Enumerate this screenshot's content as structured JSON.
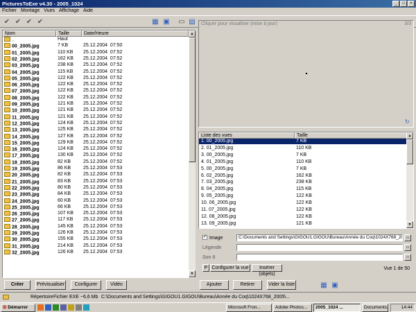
{
  "window": {
    "title": "PicturesToExe v4.30 - 2005_1024"
  },
  "menu": [
    "Fichier",
    "Montage",
    "Vues",
    "Affichage",
    "Aide"
  ],
  "file_list": {
    "columns": [
      "Nom",
      "Taille",
      "Date/Heure"
    ],
    "rows": [
      {
        "name": "..",
        "size": "Haut",
        "date": ""
      },
      {
        "name": "00_2005.jpg",
        "size": "7 KB",
        "date": "25.12.2004  07:50"
      },
      {
        "name": "01_2005.jpg",
        "size": "110 KB",
        "date": "25.12.2004  07:52"
      },
      {
        "name": "02_2005.jpg",
        "size": "162 KB",
        "date": "25.12.2004  07:52"
      },
      {
        "name": "03_2005.jpg",
        "size": "238 KB",
        "date": "25.12.2004  07:52"
      },
      {
        "name": "04_2005.jpg",
        "size": "115 KB",
        "date": "25.12.2004  07:52"
      },
      {
        "name": "05_2005.jpg",
        "size": "122 KB",
        "date": "25.12.2004  07:52"
      },
      {
        "name": "06_2005.jpg",
        "size": "122 KB",
        "date": "25.12.2004  07:52"
      },
      {
        "name": "07_2005.jpg",
        "size": "122 KB",
        "date": "25.12.2004  07:52"
      },
      {
        "name": "08_2005.jpg",
        "size": "122 KB",
        "date": "25.12.2004  07:52"
      },
      {
        "name": "09_2005.jpg",
        "size": "121 KB",
        "date": "25.12.2004  07:52"
      },
      {
        "name": "10_2005.jpg",
        "size": "121 KB",
        "date": "25.12.2004  07:52"
      },
      {
        "name": "11_2005.jpg",
        "size": "121 KB",
        "date": "25.12.2004  07:52"
      },
      {
        "name": "12_2005.jpg",
        "size": "124 KB",
        "date": "25.12.2004  07:52"
      },
      {
        "name": "13_2005.jpg",
        "size": "125 KB",
        "date": "25.12.2004  07:52"
      },
      {
        "name": "14_2005.jpg",
        "size": "127 KB",
        "date": "25.12.2004  07:52"
      },
      {
        "name": "15_2005.jpg",
        "size": "129 KB",
        "date": "25.12.2004  07:52"
      },
      {
        "name": "16_2005.jpg",
        "size": "124 KB",
        "date": "25.12.2004  07:52"
      },
      {
        "name": "17_2005.jpg",
        "size": "130 KB",
        "date": "25.12.2004  07:52"
      },
      {
        "name": "18_2005.jpg",
        "size": "82 KB",
        "date": "25.12.2004  07:52"
      },
      {
        "name": "19_2005.jpg",
        "size": "86 KB",
        "date": "25.12.2004  07:53"
      },
      {
        "name": "20_2005.jpg",
        "size": "82 KB",
        "date": "25.12.2004  07:53"
      },
      {
        "name": "21_2005.jpg",
        "size": "83 KB",
        "date": "25.12.2004  07:53"
      },
      {
        "name": "22_2005.jpg",
        "size": "80 KB",
        "date": "25.12.2004  07:53"
      },
      {
        "name": "23_2005.jpg",
        "size": "84 KB",
        "date": "25.12.2004  07:53"
      },
      {
        "name": "24_2005.jpg",
        "size": "60 KB",
        "date": "25.12.2004  07:53"
      },
      {
        "name": "25_2005.jpg",
        "size": "66 KB",
        "date": "25.12.2004  07:53"
      },
      {
        "name": "26_2005.jpg",
        "size": "107 KB",
        "date": "25.12.2004  07:53"
      },
      {
        "name": "27_2005.jpg",
        "size": "117 KB",
        "date": "25.12.2004  07:53"
      },
      {
        "name": "28_2005.jpg",
        "size": "145 KB",
        "date": "25.12.2004  07:53"
      },
      {
        "name": "29_2005.jpg",
        "size": "126 KB",
        "date": "25.12.2004  07:53"
      },
      {
        "name": "30_2005.jpg",
        "size": "155 KB",
        "date": "25.12.2004  07:53"
      },
      {
        "name": "31_2005.jpg",
        "size": "214 KB",
        "date": "25.12.2004  07:53"
      },
      {
        "name": "32_2005.jpg",
        "size": "126 KB",
        "date": "25.12.2004  07:53"
      }
    ]
  },
  "preview": {
    "hint": "Cliquer pour visualiser (mise à jour)",
    "counter": "3/3"
  },
  "slides": {
    "columns": [
      "Liste des vues",
      "Taille"
    ],
    "rows": [
      {
        "name": "1. 00_2005.jpg",
        "size": "7 KB"
      },
      {
        "name": "2. 01_2005.jpg",
        "size": "110 KB"
      },
      {
        "name": "3. 00_2005.jpg",
        "size": "7 KB"
      },
      {
        "name": "4. 01_2005.jpg",
        "size": "110 KB"
      },
      {
        "name": "5. 00_2005.jpg",
        "size": "7 KB"
      },
      {
        "name": "6. 02_2005.jpg",
        "size": "162 KB"
      },
      {
        "name": "7. 03_2005.jpg",
        "size": "238 KB"
      },
      {
        "name": "8. 04_2005.jpg",
        "size": "115 KB"
      },
      {
        "name": "9. 05_2005.jpg",
        "size": "122 KB"
      },
      {
        "name": "10. 06_2005.jpg",
        "size": "122 KB"
      },
      {
        "name": "11. 07_2005.jpg",
        "size": "122 KB"
      },
      {
        "name": "12. 08_2005.jpg",
        "size": "122 KB"
      },
      {
        "name": "13. 09_2005.jpg",
        "size": "121 KB"
      }
    ]
  },
  "props": {
    "image_label": "Image",
    "image_path": "C:\\Documents and Settings\\GIGOU1.GIGOU\\Bureau\\Année du Coq\\1024X768_20",
    "legend_label": "Légende",
    "legend_value": "",
    "sound_label": "Son 8",
    "sound_value": "",
    "configure_view": "Configurer la vue",
    "insert_objects": "Insérer (objets)",
    "view_count": "Vue 1 de 50"
  },
  "buttons": {
    "create": "Créer",
    "preview": "Prévisualiser",
    "configure": "Configurer",
    "video": "Vidéo",
    "add": "Ajouter",
    "remove": "Retirer",
    "empty": "Vider la liste"
  },
  "status": {
    "repertoire": "Répertoire",
    "exe": "Fichier EXE ~6,6 Mb",
    "path": "C:\\Documents and Settings\\GIGOU1.GIGOU\\Bureau\\Année du Coq\\1024X768_2005\\..."
  },
  "taskbar": {
    "start": "Démarrer",
    "tasks": [
      "Microsoft Fron...",
      "Adobe Photos...",
      "2005_1024 ...",
      "Documents..."
    ],
    "clock": "14:44"
  }
}
